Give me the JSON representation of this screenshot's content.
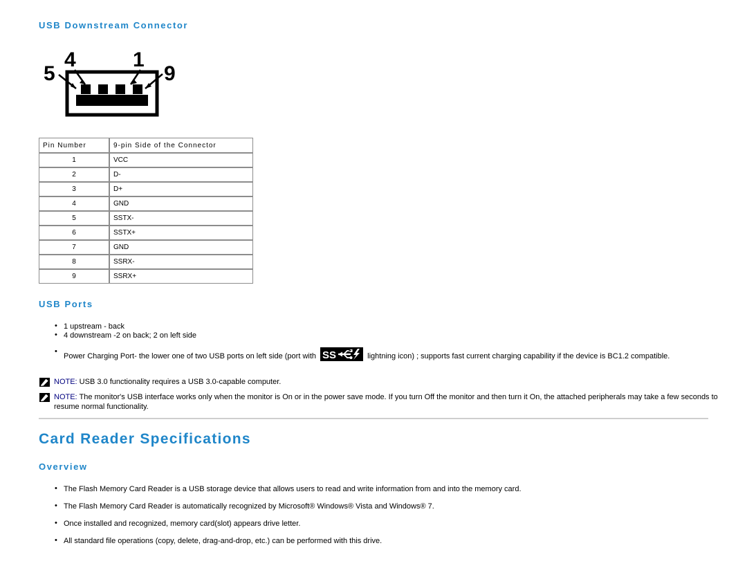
{
  "sections": {
    "usb_downstream_connector": {
      "heading": "USB Downstream Connector",
      "diagram": {
        "name": "usb-downstream-connector-diagram",
        "pin_labels": [
          "5",
          "4",
          "1",
          "9"
        ]
      },
      "table": {
        "headers": [
          "Pin Number",
          "9-pin Side of the Connector"
        ],
        "rows": [
          {
            "pin": "1",
            "signal": "VCC"
          },
          {
            "pin": "2",
            "signal": "D-"
          },
          {
            "pin": "3",
            "signal": "D+"
          },
          {
            "pin": "4",
            "signal": "GND"
          },
          {
            "pin": "5",
            "signal": "SSTX-"
          },
          {
            "pin": "6",
            "signal": "SSTX+"
          },
          {
            "pin": "7",
            "signal": "GND"
          },
          {
            "pin": "8",
            "signal": "SSRX-"
          },
          {
            "pin": "9",
            "signal": "SSRX+"
          }
        ]
      }
    },
    "usb_ports": {
      "heading": "USB Ports",
      "bullets": [
        "1 upstream - back",
        "4 downstream -2 on back; 2 on left side"
      ],
      "power_charging_bullet": {
        "text_before_icon": "Power Charging Port- the lower one of two USB ports on left side (port with",
        "icon_name": "superspeed-usb-lightning-icon",
        "text_after_icon": "lightning icon) ; supports fast current charging capability if the device is BC1.2 compatible."
      },
      "notes": [
        {
          "label": "NOTE:",
          "text": " USB 3.0 functionality requires a USB 3.0-capable computer."
        },
        {
          "label": "NOTE:",
          "text": " The monitor's USB interface works only when the monitor is On or in the power save mode. If you turn Off the monitor and then turn it On, the attached peripherals may take a few seconds to resume normal functionality."
        }
      ]
    },
    "card_reader_specifications": {
      "heading": "Card Reader Specifications",
      "overview": {
        "heading": "Overview",
        "bullets": [
          "The Flash Memory Card Reader is a USB storage device that allows users to read and write information from and into the memory card.",
          "The Flash Memory Card Reader is automatically recognized by Microsoft® Windows® Vista and Windows® 7.",
          "Once installed and recognized, memory card(slot) appears drive letter.",
          "All standard file operations (copy, delete, drag-and-drop, etc.) can be performed with this drive."
        ]
      }
    }
  },
  "colors": {
    "heading_blue": "#1f86c9",
    "note_label_blue": "#00007f",
    "table_border": "#8c8c8c",
    "divider": "#c8c8c8",
    "text": "#000000"
  }
}
